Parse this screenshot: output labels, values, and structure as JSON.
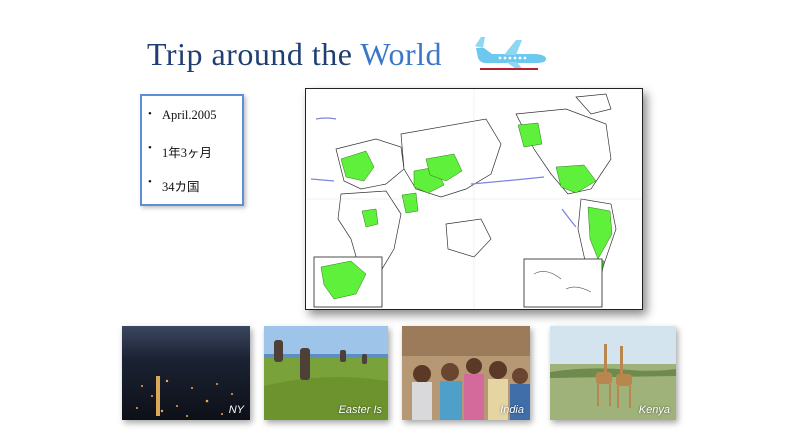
{
  "slide": {
    "title_main": "Trip around the ",
    "title_accent": "World",
    "facts": [
      "April.2005",
      "1年3ヶ月",
      "34カ国"
    ],
    "photos": [
      {
        "caption": "NY"
      },
      {
        "caption": "Easter Is"
      },
      {
        "caption": "India"
      },
      {
        "caption": "Kenya"
      }
    ],
    "icons": [
      "airplane-icon",
      "world-map"
    ],
    "colors": {
      "title": "#1f3f72",
      "accent": "#3b78c8",
      "visited": "#5ef03b",
      "route": "#7b86e0",
      "box_border": "#5b8fd6"
    }
  }
}
